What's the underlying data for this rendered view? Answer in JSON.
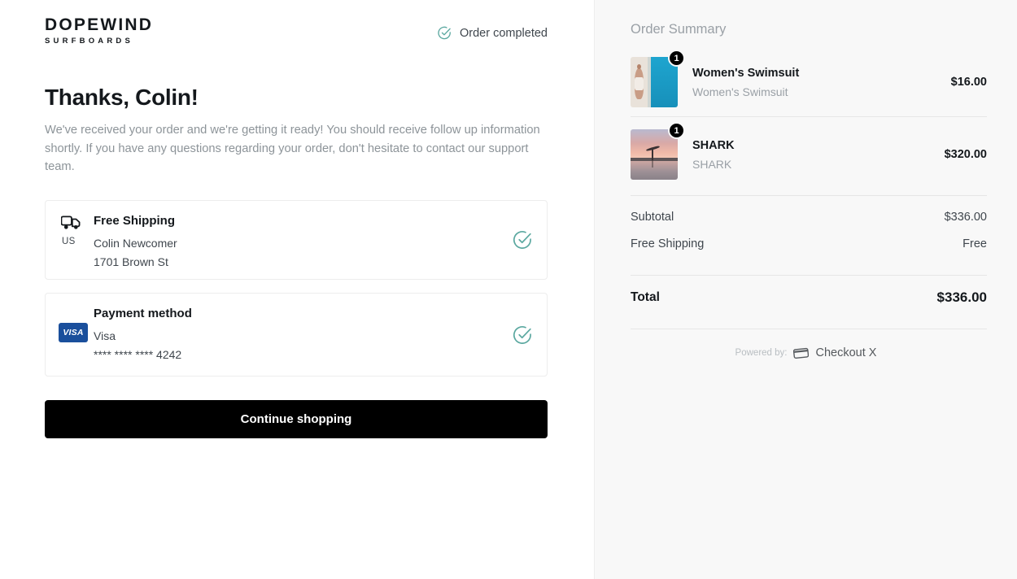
{
  "brand": {
    "name": "DOPEWIND",
    "tagline": "SURFBOARDS"
  },
  "status": {
    "label": "Order completed",
    "icon": "circle-check-icon",
    "color": "#5ba8a0"
  },
  "main": {
    "heading": "Thanks, Colin!",
    "body": "We've received your order and we're getting it ready! You should receive follow up information shortly. If you have any questions regarding your order, don't hesitate to contact our support team.",
    "shipping_card": {
      "icon": "truck-icon",
      "country_code": "US",
      "title": "Free Shipping",
      "recipient": "Colin Newcomer",
      "address": "1701 Brown St",
      "confirmed_icon": "circle-check-icon"
    },
    "payment_card": {
      "icon": "visa-icon",
      "badge_text": "VISA",
      "title": "Payment method",
      "brand": "Visa",
      "card_number": "**** **** **** 4242",
      "confirmed_icon": "circle-check-icon"
    },
    "cta_label": "Continue shopping"
  },
  "summary": {
    "title": "Order Summary",
    "items": [
      {
        "name": "Women's Swimsuit",
        "variant": "Women's Swimsuit",
        "quantity": "1",
        "price": "$16.00"
      },
      {
        "name": "SHARK",
        "variant": "SHARK",
        "quantity": "1",
        "price": "$320.00"
      }
    ],
    "totals": [
      {
        "label": "Subtotal",
        "value": "$336.00"
      },
      {
        "label": "Free Shipping",
        "value": "Free"
      }
    ],
    "grand_total": {
      "label": "Total",
      "value": "$336.00"
    },
    "powered_by": {
      "label": "Powered by:",
      "provider": "Checkout X",
      "icon": "credit-card-icon"
    }
  }
}
